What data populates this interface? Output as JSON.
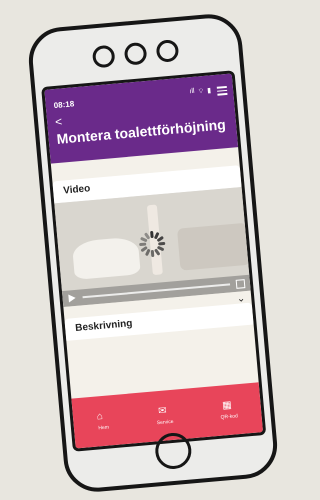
{
  "status": {
    "time": "08:18",
    "signal": "ıll",
    "wifi": "⌔",
    "battery": "▮"
  },
  "header": {
    "back_icon": "<",
    "title": "Montera toalettförhöjning"
  },
  "sections": {
    "video_label": "Video",
    "description_label": "Beskrivning"
  },
  "nav": {
    "items": [
      {
        "label": "Hem",
        "icon": "home-icon"
      },
      {
        "label": "Service",
        "icon": "mail-icon"
      },
      {
        "label": "QR-kod",
        "icon": "qr-icon"
      }
    ]
  },
  "colors": {
    "header_bg": "#6a2a8a",
    "nav_bg": "#e8455a"
  }
}
